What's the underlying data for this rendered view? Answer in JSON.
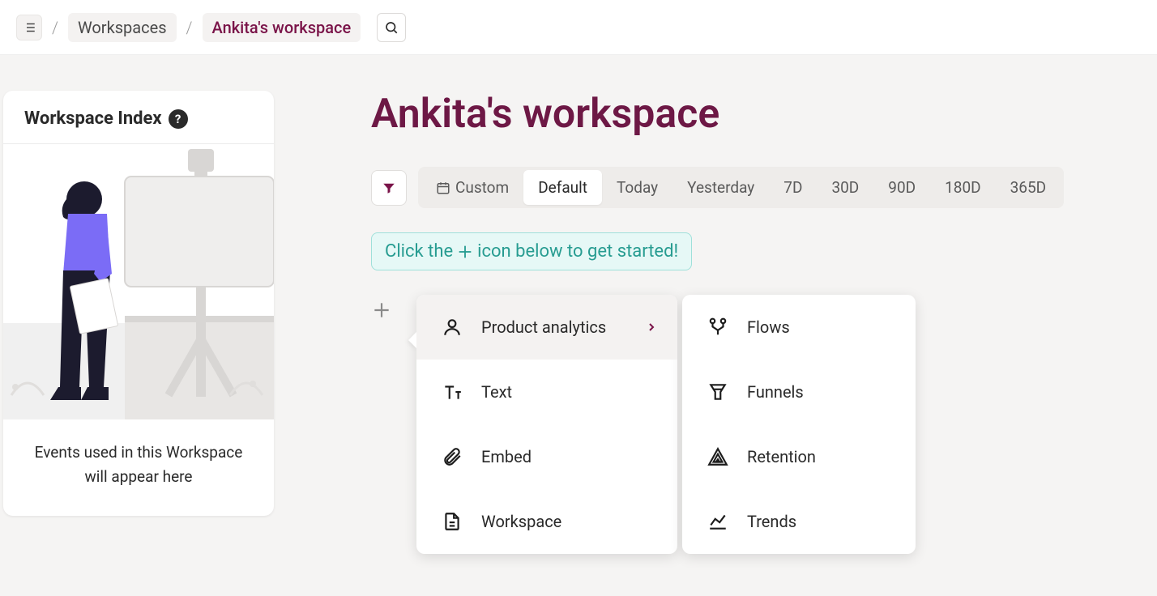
{
  "breadcrumb": {
    "root_label": "Workspaces",
    "current_label": "Ankita's workspace"
  },
  "sidebar": {
    "index_title": "Workspace Index",
    "empty_line1": "Events used in this Workspace",
    "empty_line2": "will appear here"
  },
  "main": {
    "title": "Ankita's workspace",
    "date_ranges": {
      "custom": "Custom",
      "default": "Default",
      "today": "Today",
      "yesterday": "Yesterday",
      "d7": "7D",
      "d30": "30D",
      "d90": "90D",
      "d180": "180D",
      "d365": "365D"
    },
    "hint_prefix": "Click the",
    "hint_suffix": "icon below to get started!"
  },
  "menu": {
    "primary": {
      "product_analytics": "Product analytics",
      "text": "Text",
      "embed": "Embed",
      "workspace": "Workspace"
    },
    "secondary": {
      "flows": "Flows",
      "funnels": "Funnels",
      "retention": "Retention",
      "trends": "Trends"
    }
  }
}
